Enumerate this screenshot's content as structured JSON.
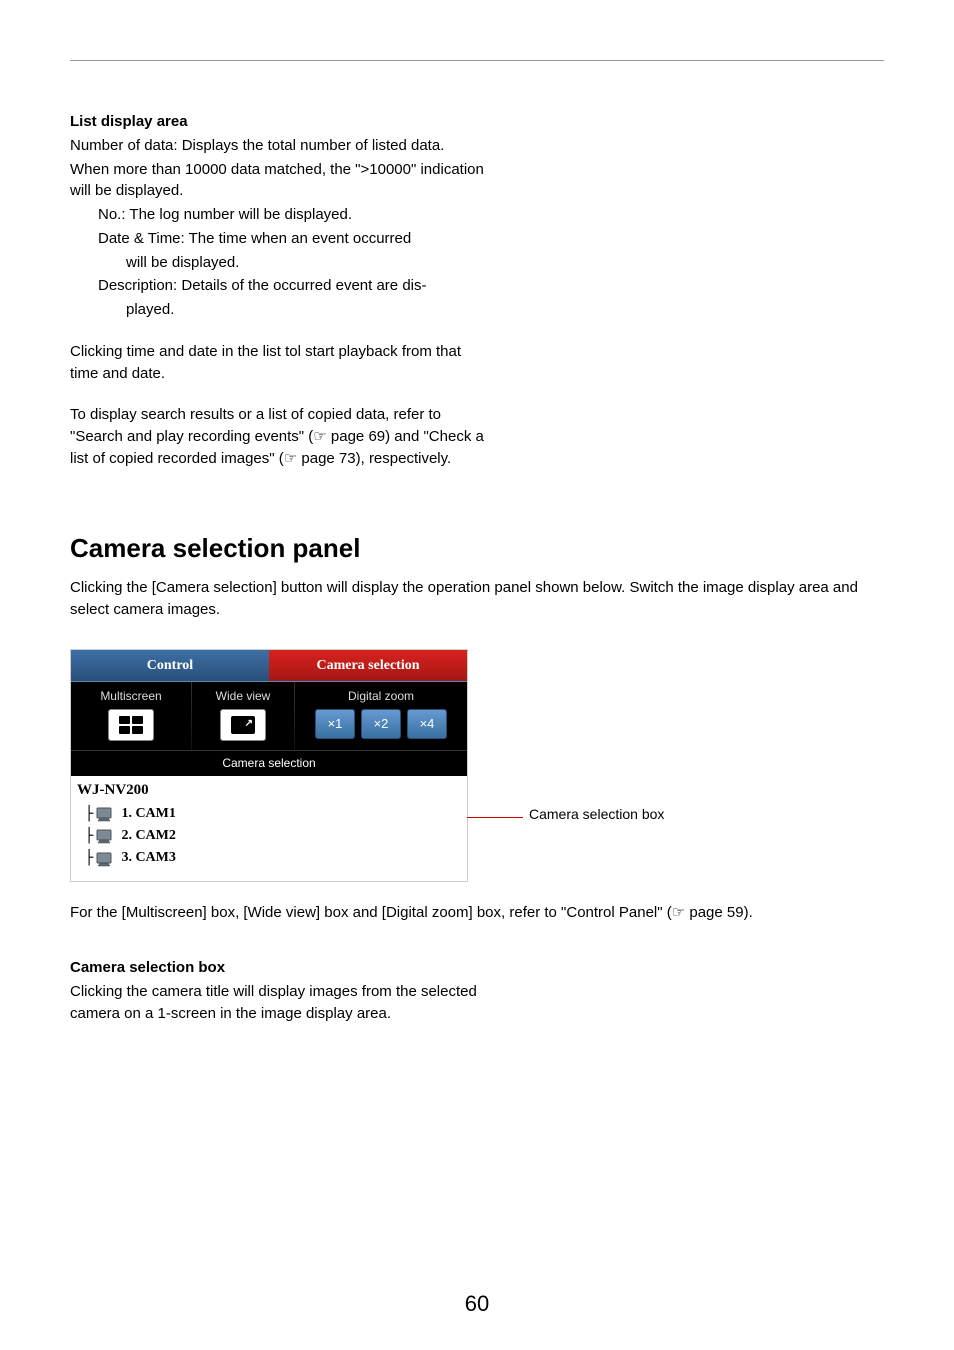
{
  "list_display": {
    "heading": "List display area",
    "line1": "Number of data: Displays the total number of listed data.",
    "line2": "When more than 10000 data matched, the \">10000\" indication will be displayed.",
    "no_label": "No.: The log number will be displayed.",
    "datetime_line1": "Date & Time: The time when an event occurred",
    "datetime_line2": "will be displayed.",
    "desc_line1": "Description: Details of the occurred event are dis-",
    "desc_line2": "played.",
    "para2": "Clicking time and date in the list tol start playback from that time and date.",
    "para3a": "To display search results or a list of copied data, refer to \"Search and play recording events\" (",
    "para3b": " page 69) and \"Check a list of copied recorded images\" (",
    "para3c": " page 73), respectively."
  },
  "refmark": "☞",
  "section": {
    "title": "Camera selection panel",
    "intro": "Clicking the [Camera selection] button will display the operation panel shown below. Switch the image display area and select camera images.",
    "footer_a": "For the [Multiscreen] box, [Wide view] box and [Digital zoom] box, refer to \"Control Panel\" (",
    "footer_b": " page 59)."
  },
  "panel": {
    "tab_control": "Control",
    "tab_camera": "Camera selection",
    "multiscreen_label": "Multiscreen",
    "wideview_label": "Wide view",
    "digitalzoom_label": "Digital zoom",
    "zoom_x1": "×1",
    "zoom_x2": "×2",
    "zoom_x4": "×4",
    "camsel_heading": "Camera selection",
    "device_name": "WJ-NV200",
    "cams": [
      "1. CAM1",
      "2. CAM2",
      "3. CAM3"
    ]
  },
  "callout_label": "Camera selection box",
  "camsel_box": {
    "heading": "Camera selection box",
    "body": "Clicking the camera title will display images from the selected camera on a 1-screen in the image display area."
  },
  "page_number": "60"
}
